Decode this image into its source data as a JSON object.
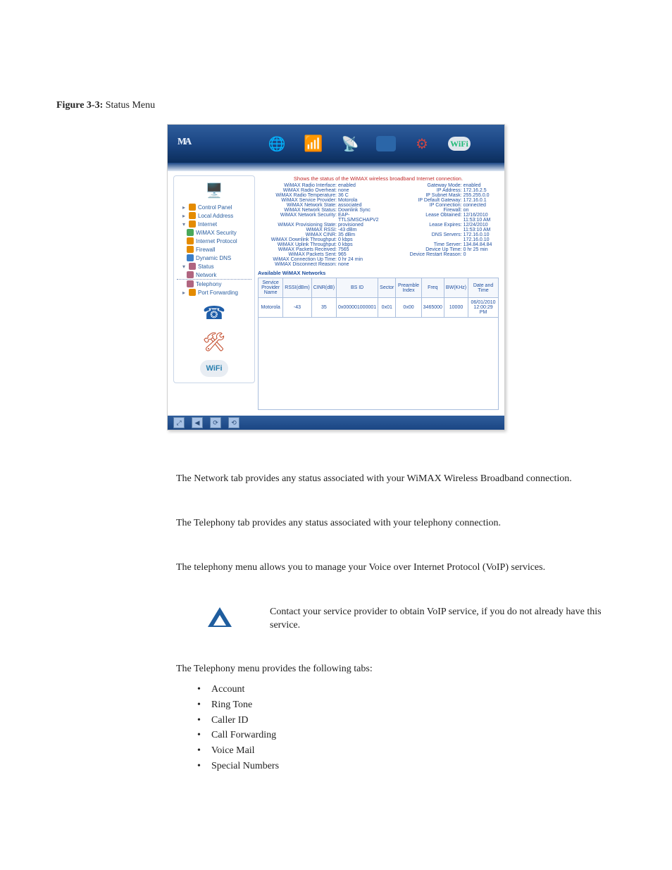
{
  "figure_number": "Figure 3-3:",
  "figure_title": "Status Menu",
  "sidebar": {
    "items": [
      {
        "label": "Control Panel"
      },
      {
        "label": "Local Address"
      },
      {
        "label": "Internet"
      },
      {
        "label": "WiMAX Security"
      },
      {
        "label": "Internet Protocol"
      },
      {
        "label": "Firewall"
      },
      {
        "label": "Dynamic DNS"
      },
      {
        "label": "Status"
      },
      {
        "label": "Network"
      },
      {
        "label": "Telephony"
      },
      {
        "label": "Port Forwarding"
      }
    ]
  },
  "status": {
    "heading": "Shows the status of the WiMAX wireless broadband Internet connection.",
    "left": [
      {
        "label": "WiMAX Radio Interface:",
        "value": "enabled"
      },
      {
        "label": "WiMAX Radio Overheat:",
        "value": "none"
      },
      {
        "label": "WiMAX Radio Temperature:",
        "value": "36 C"
      },
      {
        "label": "WiMAX Service Provider:",
        "value": "Motorola"
      },
      {
        "label": "WiMAX Network State:",
        "value": "associated"
      },
      {
        "label": "WiMAX Network Status:",
        "value": "Downlink Sync"
      },
      {
        "label": "WiMAX Network Security:",
        "value": "EAP-TTLS/MSCHAPV2"
      },
      {
        "label": "WiMAX Provisioning State:",
        "value": "provisioned"
      },
      {
        "label": "WiMAX RSSI:",
        "value": "-43 dBm"
      },
      {
        "label": "WiMAX CINR:",
        "value": "35 dBm"
      },
      {
        "label": "WiMAX Downlink Throughput:",
        "value": "0 kbps"
      },
      {
        "label": "WiMAX Uplink Throughput:",
        "value": "0 kbps"
      },
      {
        "label": "WiMAX Packets Received:",
        "value": "7565"
      },
      {
        "label": "WiMAX Packets Sent:",
        "value": "965"
      },
      {
        "label": "WiMAX Connection Up Time:",
        "value": "0 hr 24 min"
      },
      {
        "label": "WiMAX Disconnect Reason:",
        "value": "none"
      }
    ],
    "right": [
      {
        "label": "Gateway Mode:",
        "value": "enabled"
      },
      {
        "label": "IP Address:",
        "value": "172.16.2.5"
      },
      {
        "label": "IP Subnet Mask:",
        "value": "255.255.0.0"
      },
      {
        "label": "IP Default Gateway:",
        "value": "172.16.0.1"
      },
      {
        "label": "IP Connection:",
        "value": "connected"
      },
      {
        "label": "Firewall:",
        "value": "on"
      },
      {
        "label": "Lease Obtained:",
        "value": "12/16/2010 11:53:10 AM"
      },
      {
        "label": "Lease Expires:",
        "value": "12/24/2010 11:53:10 AM"
      },
      {
        "label": "DNS Servers:",
        "value": "172.16.0.10 172.16.0.10"
      },
      {
        "label": "Time Server:",
        "value": "134.84.84.84"
      },
      {
        "label": "Device Up Time:",
        "value": "0 hr 25 min"
      },
      {
        "label": "Device Restart Reason:",
        "value": "0"
      }
    ],
    "available_title": "Available WiMAX Networks"
  },
  "net_table": {
    "headers": [
      "Service Provider Name",
      "RSSI(dBm)",
      "CINR(dB)",
      "BS ID",
      "Sector",
      "Preamble Index",
      "Freq",
      "BW(KHz)",
      "Date and Time"
    ],
    "rows": [
      [
        "Motorola",
        "-43",
        "35",
        "0x000001000001",
        "0x01",
        "0x00",
        "3465000",
        "10000",
        "06/01/2010 12:00:29 PM"
      ]
    ]
  },
  "body": {
    "p_network": "The Network tab provides any status associated with your WiMAX Wireless Broadband connection.",
    "p_telephony_tab": "The Telephony tab provides any status associated with your telephony connection.",
    "p_telephony_menu": "The telephony menu allows you to manage your Voice over Internet Protocol (VoIP) services.",
    "note": "Contact your service provider to obtain VoIP service, if you do not already have this service.",
    "tabs_intro": "The Telephony menu provides the following tabs:",
    "tabs": [
      "Account",
      "Ring Tone",
      "Caller ID",
      "Call Forwarding",
      "Voice Mail",
      "Special Numbers"
    ]
  }
}
